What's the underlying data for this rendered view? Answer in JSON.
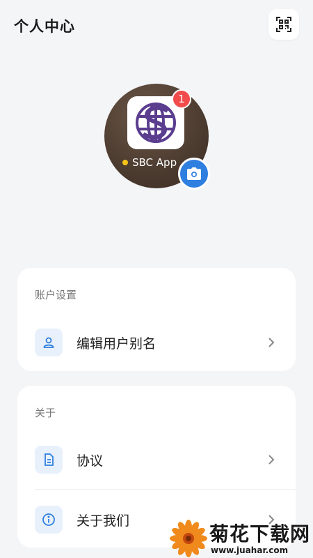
{
  "header": {
    "title": "个人中心",
    "scan_icon": "qr-scan-icon"
  },
  "profile": {
    "app_name": "SBC App",
    "badge_count": "1",
    "status_dot_color": "#f5c518",
    "app_icon": "sbc-globe-logo",
    "camera_icon": "camera-icon",
    "accent_color": "#2f7fe0",
    "badge_color": "#f24b4b"
  },
  "account_section": {
    "title": "账户设置",
    "items": [
      {
        "label": "编辑用户别名",
        "icon": "user-icon"
      }
    ]
  },
  "about_section": {
    "title": "关于",
    "items": [
      {
        "label": "协议",
        "icon": "document-icon"
      },
      {
        "label": "关于我们",
        "icon": "info-icon"
      }
    ]
  },
  "watermark": {
    "title": "菊花下载网",
    "url": "www.juahar.com"
  }
}
